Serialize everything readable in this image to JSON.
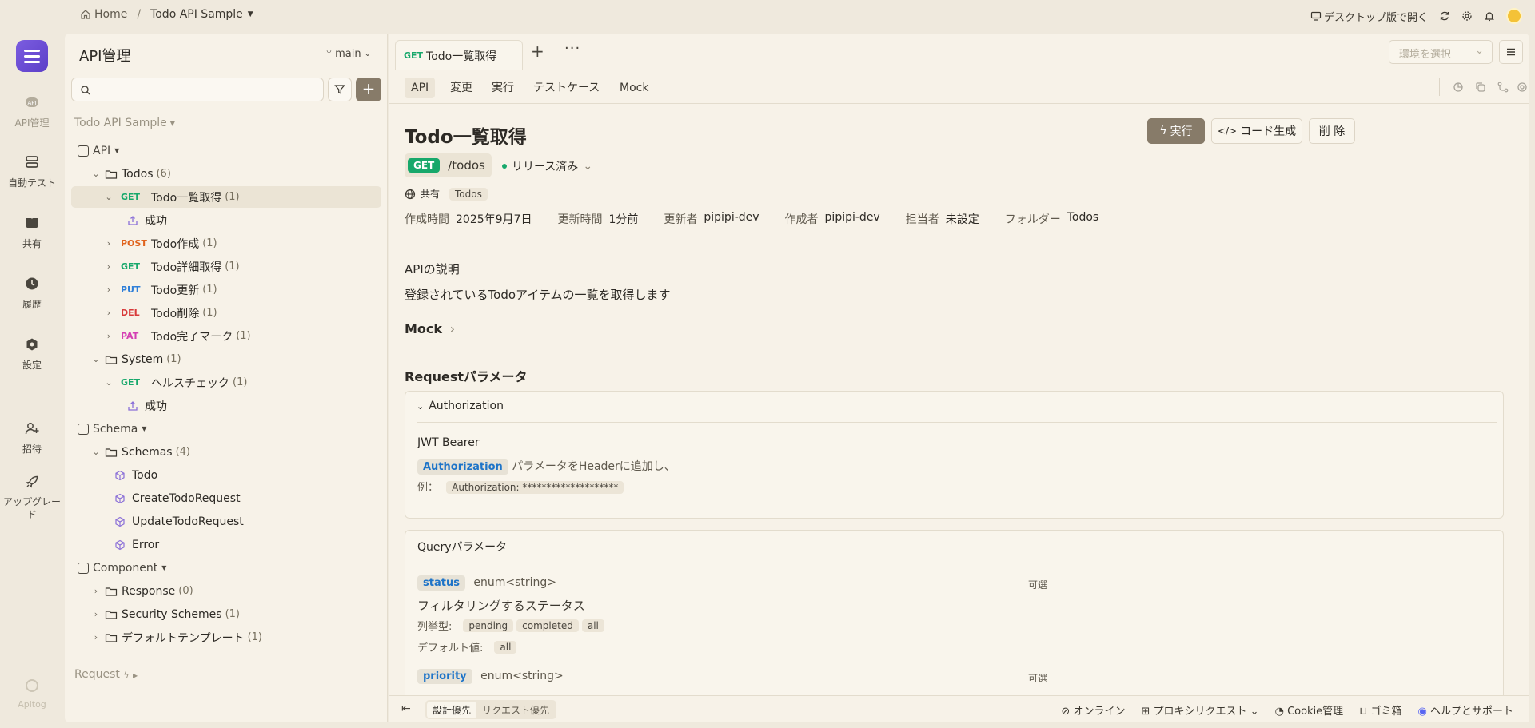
{
  "topbar": {
    "home": "Home",
    "separator": "/",
    "project": "Todo API Sample",
    "open_desktop": "デスクトップ版で開く"
  },
  "rail": {
    "items": [
      {
        "label": "API管理",
        "icon": "api-icon"
      },
      {
        "label": "自動テスト",
        "icon": "stack-icon"
      },
      {
        "label": "共有",
        "icon": "book-icon"
      },
      {
        "label": "履歴",
        "icon": "clock-icon"
      },
      {
        "label": "設定",
        "icon": "settings-icon"
      },
      {
        "label": "招待",
        "icon": "user-plus-icon"
      },
      {
        "label": "アップグレード",
        "icon": "rocket-icon"
      }
    ],
    "brand": "Apitog"
  },
  "sidebar": {
    "title": "API管理",
    "branch": "main",
    "project_label": "Todo API Sample",
    "tree": [
      {
        "indent": 0,
        "kind": "group",
        "label": "API",
        "caret": true
      },
      {
        "indent": 1,
        "kind": "folder",
        "label": "Todos",
        "count": "(6)",
        "chev": "⌄"
      },
      {
        "indent": 2,
        "kind": "endpoint",
        "method": "GET",
        "label": "Todo一覧取得",
        "count": "(1)",
        "chev": "⌄",
        "selected": true
      },
      {
        "indent": 3,
        "kind": "case",
        "label": "成功"
      },
      {
        "indent": 2,
        "kind": "endpoint",
        "method": "POST",
        "label": "Todo作成",
        "count": "(1)",
        "chev": "›"
      },
      {
        "indent": 2,
        "kind": "endpoint",
        "method": "GET",
        "label": "Todo詳細取得",
        "count": "(1)",
        "chev": "›"
      },
      {
        "indent": 2,
        "kind": "endpoint",
        "method": "PUT",
        "label": "Todo更新",
        "count": "(1)",
        "chev": "›"
      },
      {
        "indent": 2,
        "kind": "endpoint",
        "method": "DEL",
        "label": "Todo削除",
        "count": "(1)",
        "chev": "›"
      },
      {
        "indent": 2,
        "kind": "endpoint",
        "method": "PAT",
        "label": "Todo完了マーク",
        "count": "(1)",
        "chev": "›"
      },
      {
        "indent": 1,
        "kind": "folder",
        "label": "System",
        "count": "(1)",
        "chev": "⌄"
      },
      {
        "indent": 2,
        "kind": "endpoint",
        "method": "GET",
        "label": "ヘルスチェック",
        "count": "(1)",
        "chev": "⌄"
      },
      {
        "indent": 3,
        "kind": "case",
        "label": "成功"
      },
      {
        "indent": 0,
        "kind": "group",
        "label": "Schema",
        "caret": true
      },
      {
        "indent": 1,
        "kind": "folder",
        "label": "Schemas",
        "count": "(4)",
        "chev": "⌄"
      },
      {
        "indent": 2,
        "kind": "schema",
        "label": "Todo"
      },
      {
        "indent": 2,
        "kind": "schema",
        "label": "CreateTodoRequest"
      },
      {
        "indent": 2,
        "kind": "schema",
        "label": "UpdateTodoRequest"
      },
      {
        "indent": 2,
        "kind": "schema",
        "label": "Error"
      },
      {
        "indent": 0,
        "kind": "group",
        "label": "Component",
        "caret": true
      },
      {
        "indent": 1,
        "kind": "folder",
        "label": "Response",
        "count": "(0)",
        "chev": "›"
      },
      {
        "indent": 1,
        "kind": "folder",
        "label": "Security Schemes",
        "count": "(1)",
        "chev": "›"
      },
      {
        "indent": 1,
        "kind": "folder",
        "label": "デフォルトテンプレート",
        "count": "(1)",
        "chev": "›"
      }
    ],
    "request_label": "Request"
  },
  "method_colors": {
    "GET": "#17a86b",
    "POST": "#e0641e",
    "PUT": "#2f7fd8",
    "DEL": "#d83a3a",
    "PAT": "#d43fb3"
  },
  "main": {
    "tab": {
      "method": "GET",
      "label": "Todo一覧取得"
    },
    "env_placeholder": "環境を選択",
    "subtabs": [
      "API",
      "変更",
      "実行",
      "テストケース",
      "Mock"
    ],
    "title": "Todo一覧取得",
    "method_badge": "GET",
    "path": "/todos",
    "status": "リリース済み",
    "shared": "共有",
    "folder_tag": "Todos",
    "meta": [
      {
        "label": "作成時間",
        "value": "2025年9月7日"
      },
      {
        "label": "更新時間",
        "value": "1分前"
      },
      {
        "label": "更新者",
        "value": "pipipi-dev"
      },
      {
        "label": "作成者",
        "value": "pipipi-dev"
      },
      {
        "label": "担当者",
        "value": "未設定"
      },
      {
        "label": "フォルダー",
        "value": "Todos"
      }
    ],
    "buttons": {
      "run": "実行",
      "codegen": "コード生成",
      "delete": "削 除"
    },
    "desc_heading": "APIの説明",
    "desc_text": "登録されているTodoアイテムの一覧を取得します",
    "mock_heading": "Mock",
    "request_heading": "Requestパラメータ",
    "auth": {
      "title": "Authorization",
      "scheme": "JWT Bearer",
      "pill": "Authorization",
      "text": "パラメータをHeaderに追加し、",
      "example_label": "例：",
      "example_value": "Authorization: ********************"
    },
    "query": {
      "title": "Queryパラメータ",
      "params": [
        {
          "name": "status",
          "type": "enum<string>",
          "optional": "可選",
          "desc": "フィルタリングするステータス",
          "enum_label": "列挙型:",
          "enum": [
            "pending",
            "completed",
            "all"
          ],
          "default_label": "デフォルト値:",
          "default": "all"
        },
        {
          "name": "priority",
          "type": "enum<string>",
          "optional": "可選"
        }
      ]
    },
    "bottom": {
      "design_first": "設計優先",
      "request_first": "リクエスト優先",
      "online": "オンライン",
      "proxy": "プロキシリクエスト",
      "cookie": "Cookie管理",
      "trash": "ゴミ箱",
      "help": "ヘルプとサポート"
    }
  }
}
